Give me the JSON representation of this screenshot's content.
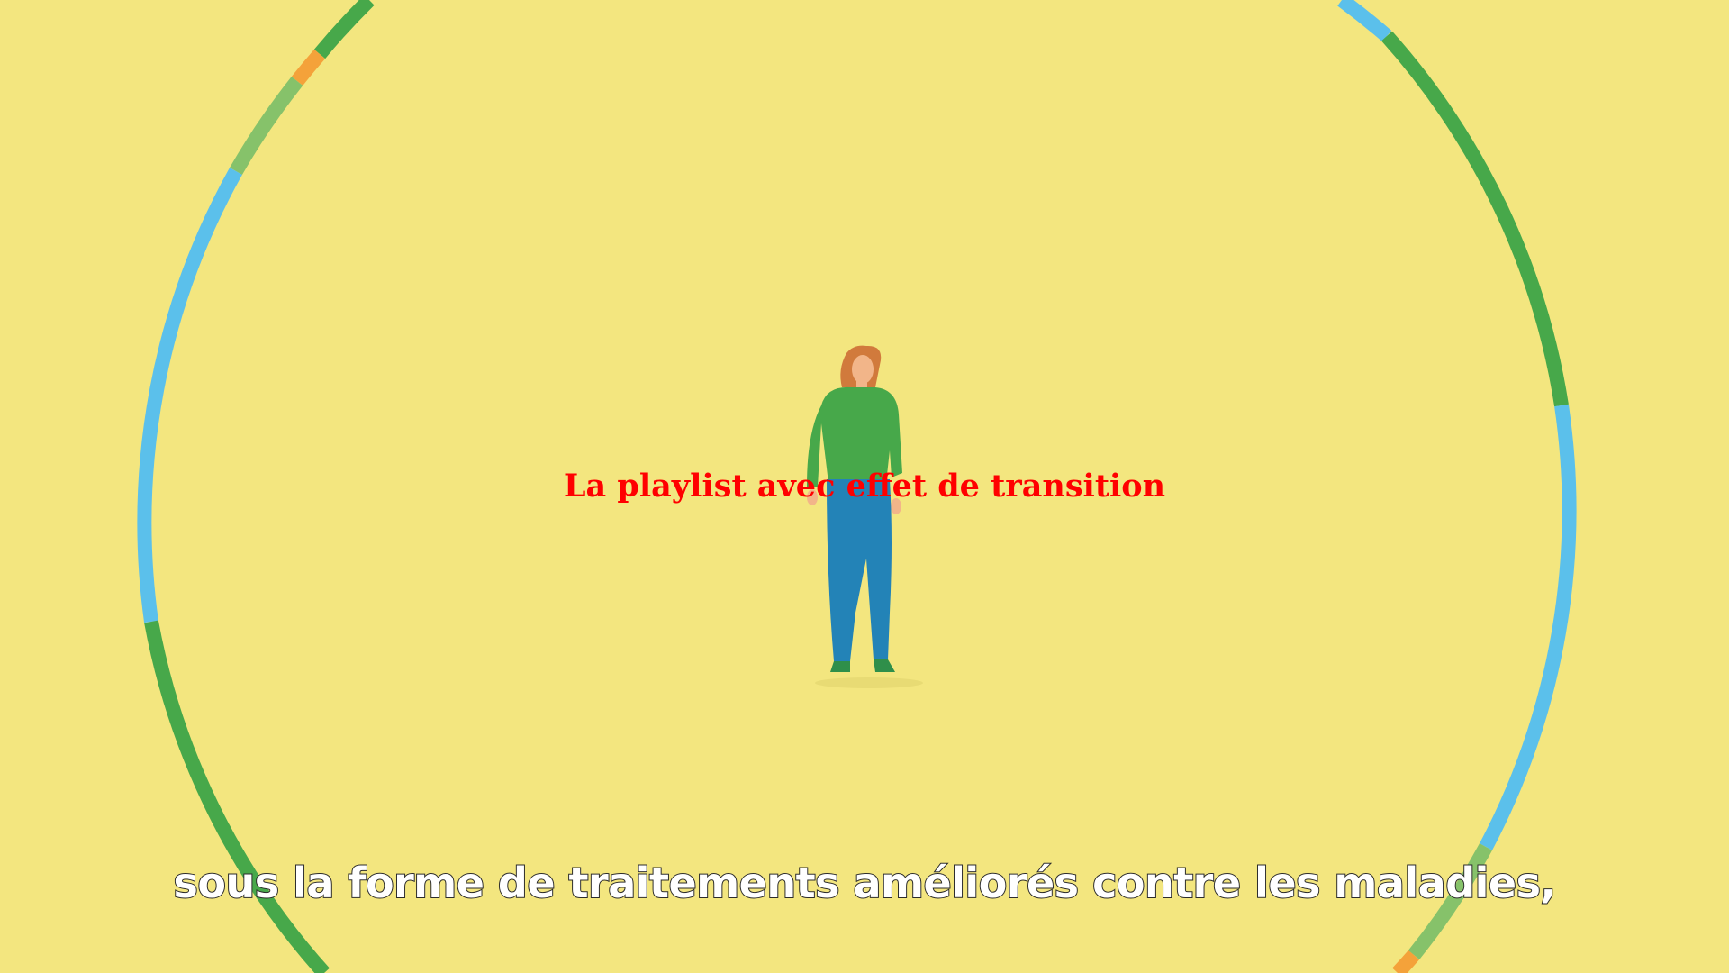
{
  "video": {
    "overlay_title": "La playlist avec effet de transition",
    "subtitle": "sous la forme de traitements améliorés contre les maladies,"
  },
  "colors": {
    "background": "#f3e67f",
    "ring_green": "#47a84a",
    "ring_light_green": "#86c26a",
    "ring_blue": "#5bc0eb",
    "ring_orange": "#f4a23a",
    "overlay_title": "#ff0000",
    "subtitle_text": "#ffffff",
    "subtitle_outline": "#2b2b2b"
  }
}
